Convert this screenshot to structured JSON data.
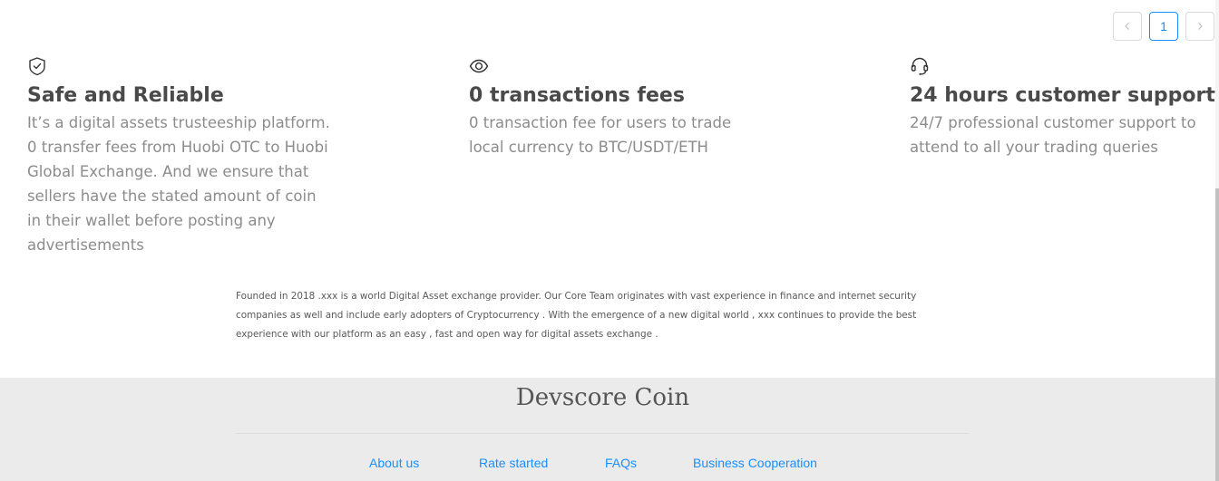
{
  "pagination": {
    "prev_icon": "chevron-left-icon",
    "current_page": "1",
    "next_icon": "chevron-right-icon"
  },
  "features": [
    {
      "icon": "shield-check-icon",
      "title": "Safe and Reliable",
      "description": "It’s a digital assets trusteeship platform. 0 transfer fees from Huobi OTC to Huobi Global Exchange. And we ensure that sellers have the stated amount of coin in their wallet before posting any advertisements"
    },
    {
      "icon": "eye-icon",
      "title": "0 transactions fees",
      "description": "0 transaction fee for users to trade local currency to BTC/USDT/ETH"
    },
    {
      "icon": "headset-icon",
      "title": "24 hours customer support",
      "description": "24/7 professional customer support to attend to all your trading queries"
    }
  ],
  "about": {
    "text": "Founded in 2018 .xxx is a world Digital Asset exchange provider. Our Core Team originates with vast experience in finance and internet security companies as well and include early adopters of Cryptocurrency . With the emergence of a new digital world , xxx continues to provide the best experience with our platform as an easy , fast and open way for digital assets exchange ."
  },
  "footer": {
    "brand": "Devscore Coin",
    "links": {
      "about": "About us",
      "rate": "Rate started",
      "faq": "FAQs",
      "business": "Business Cooperation"
    }
  },
  "colors": {
    "accent": "#1890ff",
    "footer_bg": "#ebebeb",
    "heading": "#4a4a4a",
    "body_text": "#8c8c8c"
  }
}
